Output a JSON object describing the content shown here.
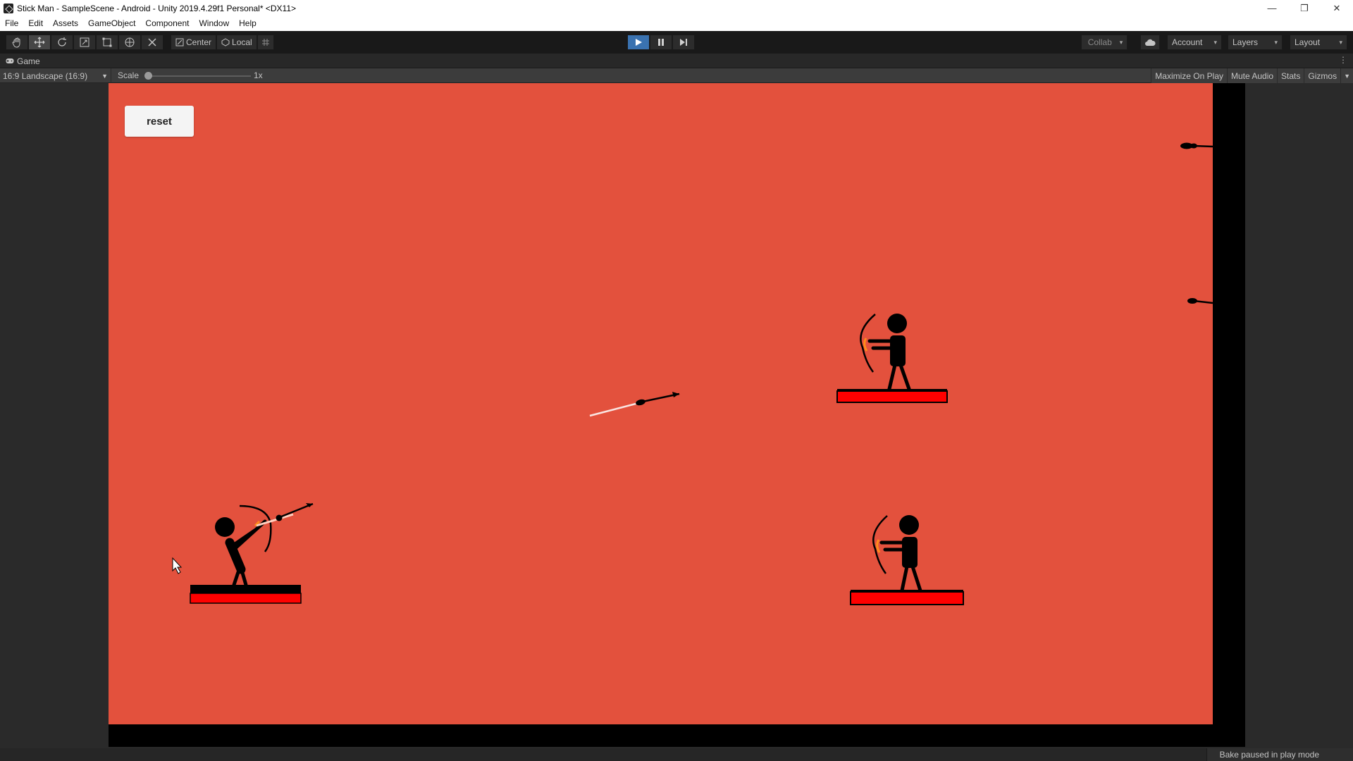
{
  "window": {
    "title": "Stick Man - SampleScene - Android - Unity 2019.4.29f1 Personal* <DX11>",
    "controls": {
      "minimize": "—",
      "restore": "❐",
      "close": "✕"
    }
  },
  "menu": [
    "File",
    "Edit",
    "Assets",
    "GameObject",
    "Component",
    "Window",
    "Help"
  ],
  "toolbar": {
    "pivot_label": "Center",
    "space_label": "Local",
    "collab_label": "Collab",
    "account_label": "Account",
    "layers_label": "Layers",
    "layout_label": "Layout",
    "play_state": "playing",
    "colors": {
      "play_active": "#3a72b0",
      "toolbar_bg": "#191919"
    }
  },
  "game_tab": {
    "label": "Game",
    "more": "⋮"
  },
  "game_controls": {
    "aspect": "16:9 Landscape (16:9)",
    "scale_label": "Scale",
    "scale_value": "1x",
    "scale_fraction": 0,
    "maximize_on_play": "Maximize On Play",
    "mute_audio": "Mute Audio",
    "stats": "Stats",
    "gizmos": "Gizmos"
  },
  "game": {
    "reset_label": "reset",
    "background_color": "#e3513d"
  },
  "status": {
    "message": "Bake paused in play mode"
  }
}
